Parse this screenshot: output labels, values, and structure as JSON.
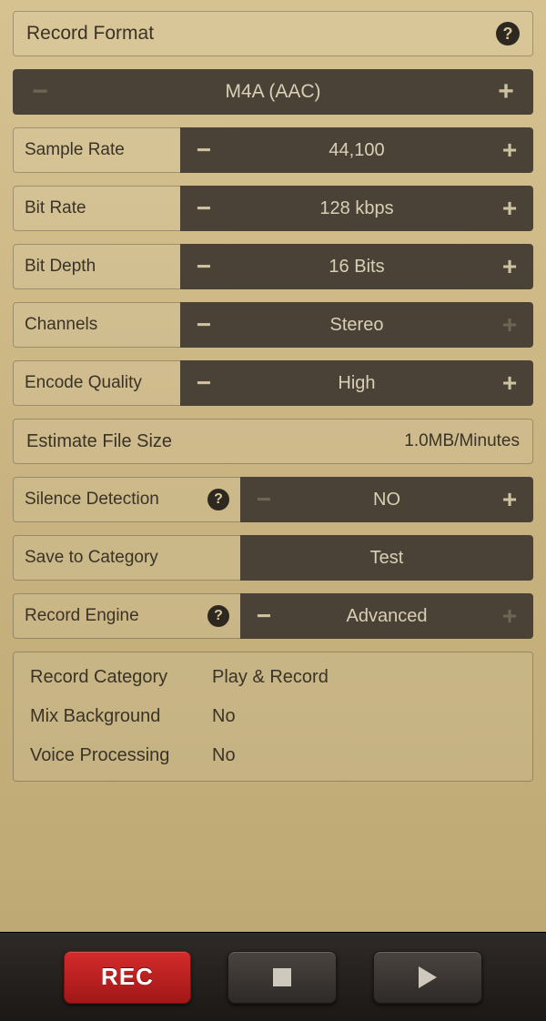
{
  "header": {
    "title": "Record Format"
  },
  "format": {
    "value": "M4A (AAC)"
  },
  "rows": {
    "sample_rate": {
      "label": "Sample Rate",
      "value": "44,100"
    },
    "bit_rate": {
      "label": "Bit Rate",
      "value": "128 kbps"
    },
    "bit_depth": {
      "label": "Bit Depth",
      "value": "16 Bits"
    },
    "channels": {
      "label": "Channels",
      "value": "Stereo"
    },
    "encode_q": {
      "label": "Encode Quality",
      "value": "High"
    },
    "silence": {
      "label": "Silence Detection",
      "value": "NO"
    },
    "save_cat": {
      "label": "Save to Category",
      "value": "Test"
    },
    "engine": {
      "label": "Record Engine",
      "value": "Advanced"
    }
  },
  "estimate": {
    "label": "Estimate File Size",
    "value": "1.0MB/Minutes"
  },
  "summary": {
    "record_category": {
      "label": "Record Category",
      "value": "Play & Record"
    },
    "mix_background": {
      "label": "Mix Background",
      "value": "No"
    },
    "voice_proc": {
      "label": "Voice Processing",
      "value": "No"
    }
  },
  "toolbar": {
    "rec_label": "REC"
  }
}
